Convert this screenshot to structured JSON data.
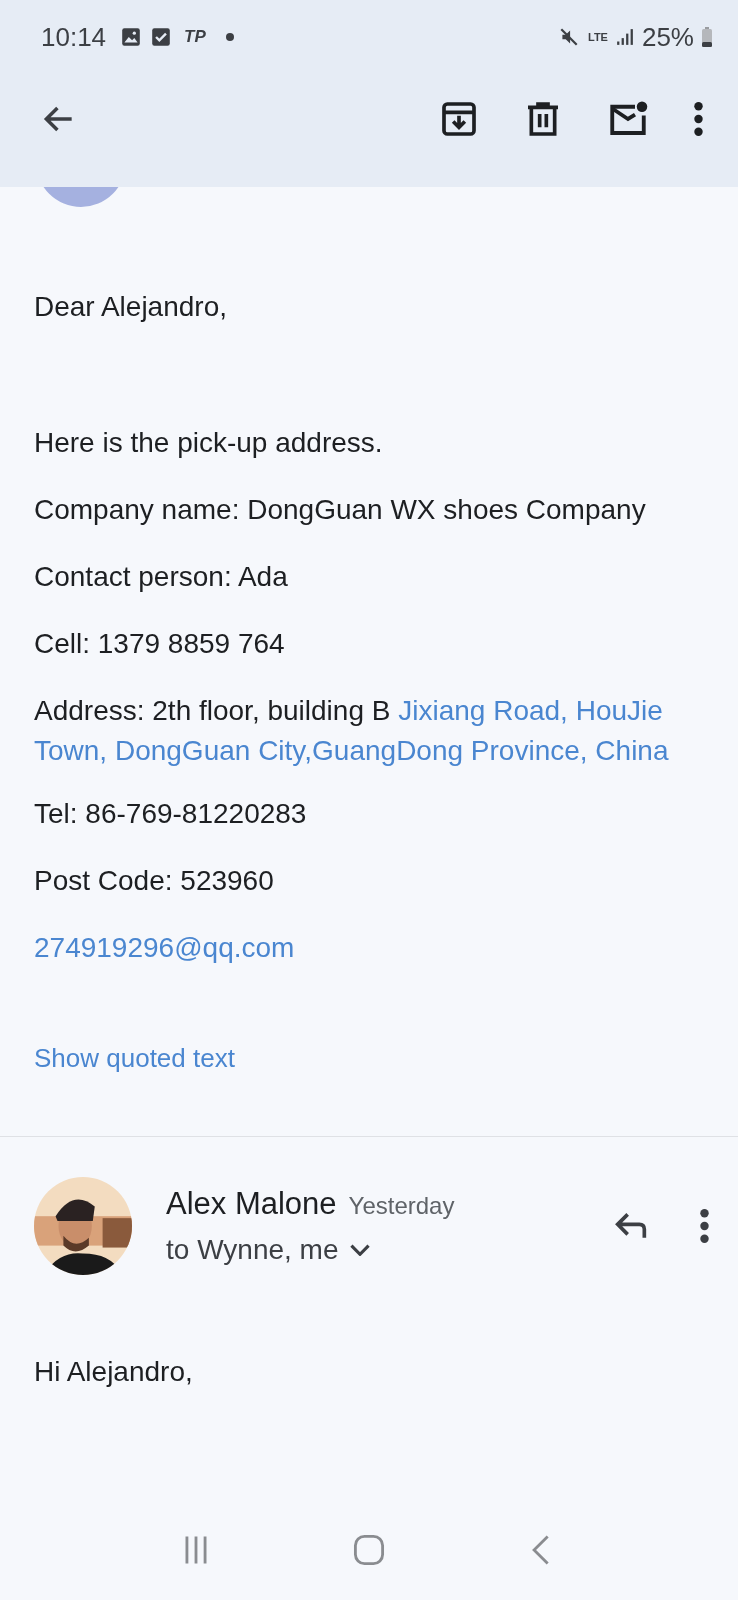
{
  "status_bar": {
    "time": "10:14",
    "notification_text": "TP",
    "network": "LTE",
    "battery": "25%"
  },
  "message_1": {
    "greeting": "Dear Alejandro,",
    "paragraphs": [
      {
        "kind": "text",
        "text": "Here is the pick-up address."
      },
      {
        "kind": "text",
        "text": "Company name: DongGuan WX shoes Company"
      },
      {
        "kind": "text",
        "text": "Contact person: Ada"
      },
      {
        "kind": "text",
        "text": "Cell: 1379 8859 764"
      },
      {
        "kind": "address",
        "text": "Address: 2th floor, building B",
        "link_lines": [
          "Jixiang Road, HouJie",
          "Town, DongGuan City,GuangDong Province, China"
        ]
      },
      {
        "kind": "text",
        "text": "Tel: 86-769-81220283"
      },
      {
        "kind": "text",
        "text": "Post Code: 523960"
      },
      {
        "kind": "link",
        "text": "274919296@qq.com"
      }
    ],
    "show_quoted": "Show quoted text"
  },
  "message_2": {
    "sender": "Alex Malone",
    "time": "Yesterday",
    "recipients": "to Wynne, me",
    "body": "Hi Alejandro,"
  }
}
